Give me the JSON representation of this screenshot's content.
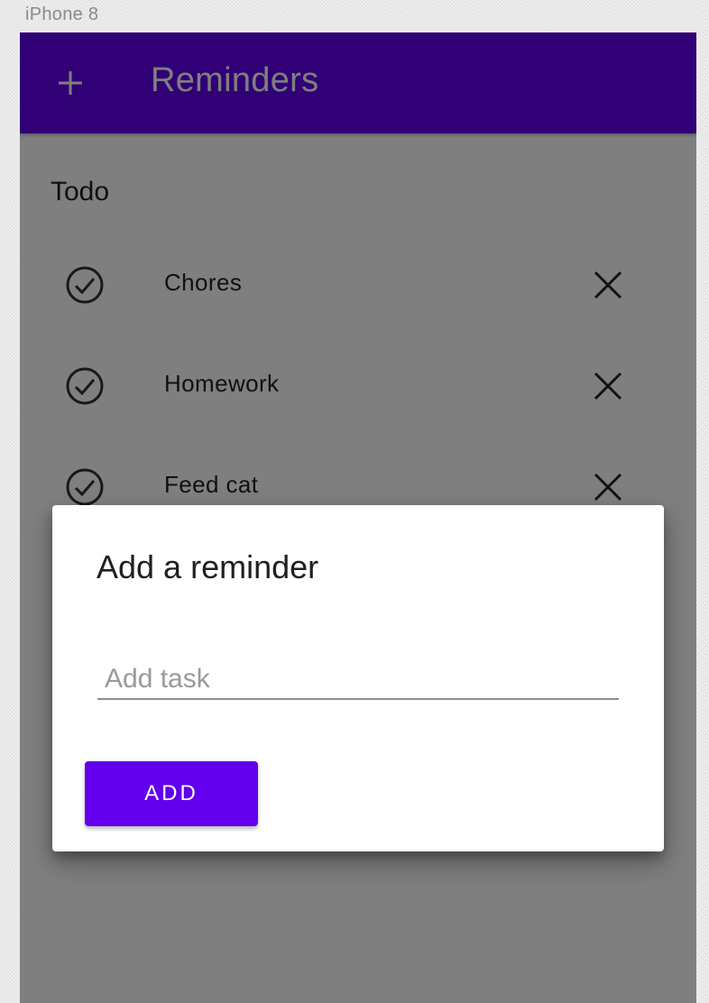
{
  "device": {
    "label": "iPhone 8"
  },
  "app_bar": {
    "title": "Reminders",
    "add_icon": "plus-icon",
    "color": "#6200ee"
  },
  "todo": {
    "title": "Todo",
    "items": [
      {
        "label": "Chores",
        "check_icon": "check-circle-icon",
        "delete_icon": "close-icon"
      },
      {
        "label": "Homework",
        "check_icon": "check-circle-icon",
        "delete_icon": "close-icon"
      },
      {
        "label": "Feed cat",
        "check_icon": "check-circle-icon",
        "delete_icon": "close-icon"
      }
    ]
  },
  "dialog": {
    "title": "Add a reminder",
    "input": {
      "value": "",
      "placeholder": "Add task"
    },
    "add_button_label": "ADD",
    "button_color": "#6200ee"
  }
}
